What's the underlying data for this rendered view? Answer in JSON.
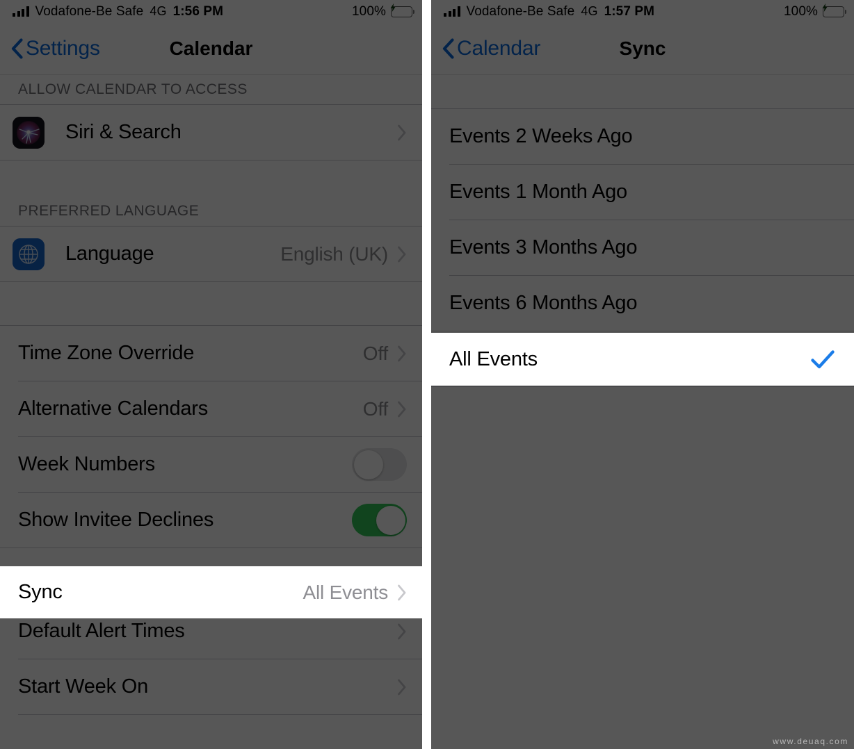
{
  "colors": {
    "tint_blue": "#0a68d8",
    "check_blue": "#1a7ce8",
    "toggle_on_green": "#34c759",
    "battery_green": "#13b013",
    "separator": "#c8c7cc",
    "section_header_text": "#6d6d72",
    "value_text": "#8a8a8e",
    "dim_overlay": "rgba(0,0,0,0.66)"
  },
  "watermark": "www.deuaq.com",
  "left_panel": {
    "status_bar": {
      "signal_icon": "signal-bars-icon",
      "carrier": "Vodafone-Be Safe",
      "network": "4G",
      "time": "1:56 PM",
      "battery_percent": "100%",
      "battery_icon": "battery-charging-icon"
    },
    "nav": {
      "back_icon": "chevron-left-icon",
      "back_label": "Settings",
      "title": "Calendar"
    },
    "sections": [
      {
        "header": "ALLOW CALENDAR TO ACCESS",
        "rows": [
          {
            "label": "Siri & Search",
            "icon": "siri-app-icon",
            "value": "",
            "accessory": "chevron"
          }
        ]
      },
      {
        "header": "PREFERRED LANGUAGE",
        "rows": [
          {
            "label": "Language",
            "icon": "globe-language-icon",
            "value": "English (UK)",
            "accessory": "chevron"
          }
        ]
      },
      {
        "header": "",
        "rows": [
          {
            "label": "Time Zone Override",
            "icon": "",
            "value": "Off",
            "accessory": "chevron"
          },
          {
            "label": "Alternative Calendars",
            "icon": "",
            "value": "Off",
            "accessory": "chevron"
          },
          {
            "label": "Week Numbers",
            "icon": "",
            "value": "",
            "accessory": "toggle-off"
          },
          {
            "label": "Show Invitee Declines",
            "icon": "",
            "value": "",
            "accessory": "toggle-on"
          }
        ]
      }
    ],
    "highlighted_row": {
      "label": "Sync",
      "value": "All Events",
      "accessory": "chevron"
    },
    "bottom_rows": [
      {
        "label": "Default Alert Times",
        "value": "",
        "accessory": "chevron"
      },
      {
        "label": "Start Week On",
        "value": "",
        "accessory": "chevron"
      }
    ]
  },
  "right_panel": {
    "status_bar": {
      "signal_icon": "signal-bars-icon",
      "carrier": "Vodafone-Be Safe",
      "network": "4G",
      "time": "1:57 PM",
      "battery_percent": "100%",
      "battery_icon": "battery-charging-icon"
    },
    "nav": {
      "back_icon": "chevron-left-icon",
      "back_label": "Calendar",
      "title": "Sync"
    },
    "options": [
      {
        "label": "Events 2 Weeks Ago",
        "selected": false
      },
      {
        "label": "Events 1 Month Ago",
        "selected": false
      },
      {
        "label": "Events 3 Months Ago",
        "selected": false
      },
      {
        "label": "Events 6 Months Ago",
        "selected": false
      }
    ],
    "selected_option": {
      "label": "All Events",
      "selected": true,
      "check_icon": "checkmark-icon"
    }
  }
}
